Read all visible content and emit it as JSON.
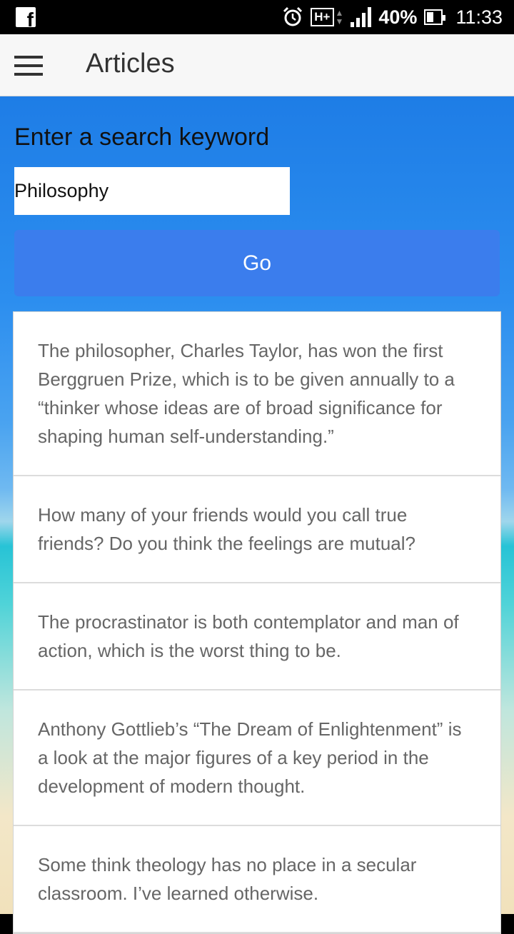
{
  "status_bar": {
    "battery": "40%",
    "battery_level": 0.4,
    "network": "H+",
    "time": "11:33",
    "icons": [
      "facebook-icon",
      "alarm-icon",
      "hplus-icon",
      "signal-icon",
      "battery-icon"
    ]
  },
  "app_bar": {
    "title": "Articles"
  },
  "search": {
    "label": "Enter a search keyword",
    "value": "Philosophy",
    "go_label": "Go"
  },
  "articles": [
    {
      "text": "The philosopher, Charles Taylor, has won the first Berggruen Prize, which is to be given annually to a “thinker whose ideas are of broad significance for shaping human self-understanding.”"
    },
    {
      "text": "How many of your friends would you call true friends? Do you think the feelings are mutual?"
    },
    {
      "text": "The procrastinator is both contemplator and man of action, which is the worst thing to be."
    },
    {
      "text": "Anthony Gottlieb’s “The Dream of Enlightenment” is a look at the major figures of a key period in the development of modern thought."
    },
    {
      "text": "Some think theology has no place in a secular classroom. I’ve learned otherwise."
    }
  ],
  "colors": {
    "go_button": "#3b7ded",
    "app_bar": "#f7f7f7"
  }
}
